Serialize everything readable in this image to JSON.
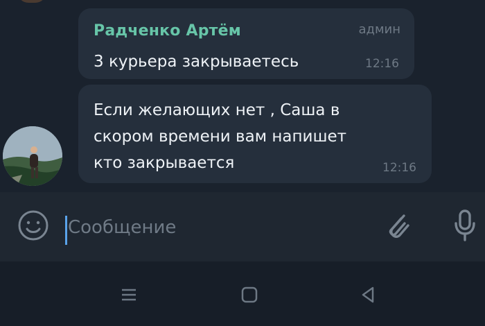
{
  "messages": [
    {
      "sender": "Радченко Артём",
      "role": "админ",
      "text": "3 курьера закрываетесь",
      "time": "12:16"
    },
    {
      "text_lines": [
        "Если желающих нет , Саша в",
        "скором времени вам напишет",
        "кто закрывается"
      ],
      "time": "12:16"
    }
  ],
  "composer": {
    "placeholder": "Сообщение",
    "value": ""
  },
  "colors": {
    "sender_name": "#67c5a8",
    "bubble": "#252f3c",
    "chat_background": "#1a222d",
    "cursor": "#5aa3ea"
  },
  "icons": {
    "composer": [
      "emoji-icon",
      "paperclip-icon",
      "microphone-icon"
    ],
    "navigation": [
      "menu-icon",
      "home-icon",
      "back-icon"
    ]
  }
}
